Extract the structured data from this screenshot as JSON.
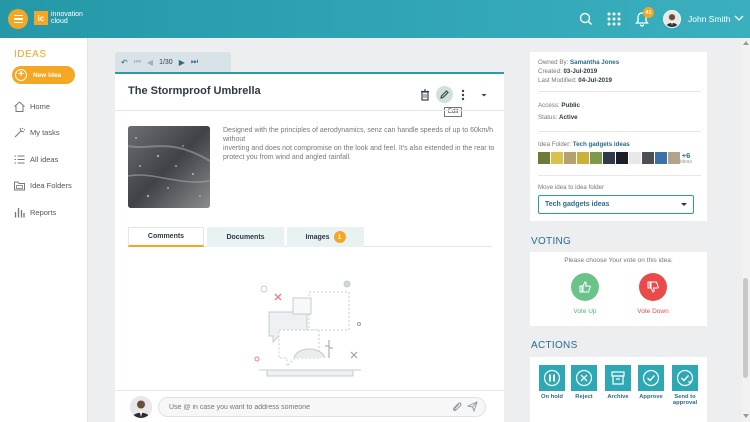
{
  "header": {
    "logo_mark": "ic",
    "logo_text_1": "innovation",
    "logo_text_2": "cloud",
    "notification_count": "41",
    "user_name": "John Smith"
  },
  "sidebar": {
    "title": "IDEAS",
    "new_idea": "New Idea",
    "items": [
      {
        "label": "Home",
        "icon": "home-icon"
      },
      {
        "label": "My tasks",
        "icon": "tasks-icon"
      },
      {
        "label": "All ideas",
        "icon": "list-icon"
      },
      {
        "label": "Idea Folders",
        "icon": "folder-icon"
      },
      {
        "label": "Reports",
        "icon": "chart-icon"
      }
    ]
  },
  "pager": {
    "current": "1/30"
  },
  "idea": {
    "title": "The Stormproof Umbrella",
    "tooltip": "Edit",
    "description_lines": [
      "Designed with the principles of aerodynamics, senz can handle speeds of up to 60km/h without",
      "inverting and does not compromise on the look and feel. It's also extended in the rear to",
      "protect you from wind and angled rainfall."
    ],
    "tabs": [
      {
        "label": "Comments"
      },
      {
        "label": "Documents"
      },
      {
        "label": "Images",
        "badge": "1"
      }
    ],
    "comment_placeholder": "Use @ in case you want to address someone"
  },
  "info": {
    "owned_label": "Owned By:",
    "owned_value": "Samantha Jones",
    "created_label": "Created:",
    "created_value": "03-Jul-2019",
    "modified_label": "Last Modified:",
    "modified_value": "04-Jul-2019",
    "access_label": "Access:",
    "access_value": "Public",
    "status_label": "Status:",
    "status_value": "Active",
    "folder_label": "Idea Folder:",
    "folder_value": "Tech gadgets ideas",
    "more_count": "+6",
    "more_label": "ideas",
    "move_label": "Move idea to idea folder",
    "move_selected": "Tech gadgets ideas"
  },
  "voting": {
    "title": "VOTING",
    "prompt": "Please choose Your vote on this idea:",
    "up": "Vote Up",
    "down": "Vote Down",
    "up_color": "#6cc38a",
    "down_color": "#e94b4b"
  },
  "actions": {
    "title": "ACTIONS",
    "items": [
      {
        "label": "On hold",
        "label2": ""
      },
      {
        "label": "Reject",
        "label2": ""
      },
      {
        "label": "Archive",
        "label2": ""
      },
      {
        "label": "Approve",
        "label2": ""
      },
      {
        "label": "Send to",
        "label2": "approval"
      }
    ]
  }
}
